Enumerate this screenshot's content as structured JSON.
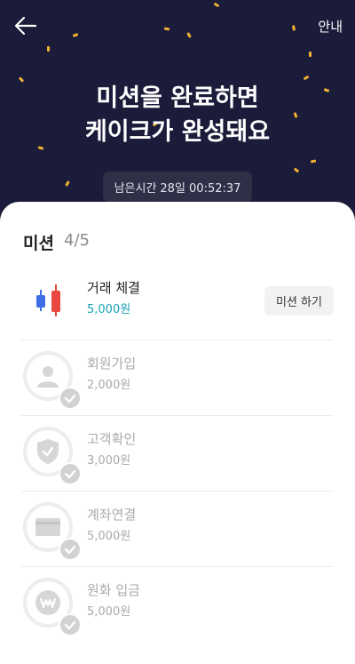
{
  "header": {
    "back_icon": "arrow-left-icon",
    "guide_label": "안내",
    "headline_line1": "미션을 완료하면",
    "headline_line2": "케이크가 완성돼요",
    "timer_label": "남은시간",
    "timer_value": "28일 00:52:37"
  },
  "missions_section": {
    "title": "미션",
    "progress": "4/5"
  },
  "missions": [
    {
      "title": "거래 체결",
      "reward": "5,000원",
      "button_label": "미션 하기",
      "completed": false,
      "icon": "candlestick-chart-icon"
    },
    {
      "title": "회원가입",
      "reward": "2,000원",
      "completed": true,
      "icon": "user-icon"
    },
    {
      "title": "고객확인",
      "reward": "3,000원",
      "completed": true,
      "icon": "shield-check-icon"
    },
    {
      "title": "계좌연결",
      "reward": "5,000원",
      "completed": true,
      "icon": "card-icon"
    },
    {
      "title": "원화 입금",
      "reward": "5,000원",
      "completed": true,
      "icon": "krw-coin-icon"
    }
  ],
  "colors": {
    "hero_bg": "#1b1b3a",
    "accent": "#1aa3b5",
    "confetti": "#f2b233",
    "candle_red": "#e9483f",
    "candle_blue": "#3d6ee6"
  }
}
